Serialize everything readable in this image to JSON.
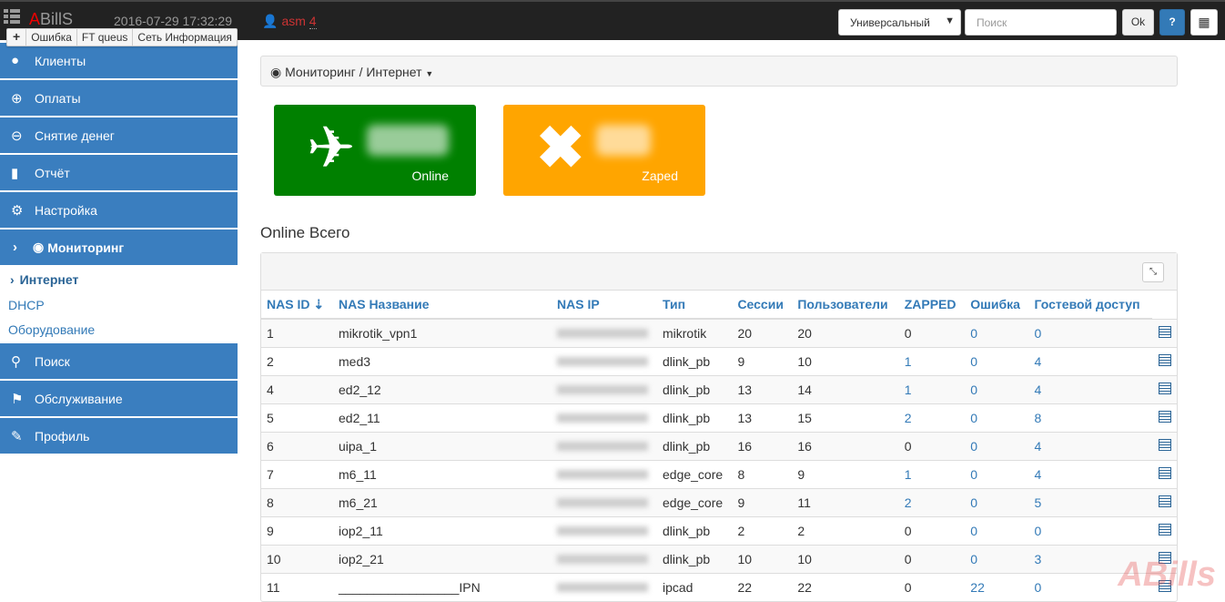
{
  "topbar": {
    "logo_first": "A",
    "logo_rest": "BillS",
    "datetime": "2016-07-29 17:32:29",
    "user": "asm",
    "user_num": "4",
    "select": "Универсальный",
    "search_placeholder": "Поиск",
    "ok": "Ok",
    "help": "?"
  },
  "quick": [
    "+",
    "Ошибка",
    "FT queus",
    "Сеть Информация"
  ],
  "sidebar": {
    "items": [
      {
        "label": "Клиенты",
        "icon": "user-icon"
      },
      {
        "label": "Оплаты",
        "icon": "plus-circle-icon"
      },
      {
        "label": "Снятие денег",
        "icon": "minus-circle-icon"
      },
      {
        "label": "Отчёт",
        "icon": "bar-chart-icon"
      },
      {
        "label": "Настройка",
        "icon": "gear-icon"
      },
      {
        "label": "Мониторинг",
        "icon": "eye-icon"
      }
    ],
    "sub": [
      "Интернет",
      "DHCP",
      "Оборудование"
    ],
    "items2": [
      {
        "label": "Поиск",
        "icon": "search-icon"
      },
      {
        "label": "Обслуживание",
        "icon": "flag-icon"
      },
      {
        "label": "Профиль",
        "icon": "wrench-icon"
      }
    ]
  },
  "breadcrumb": "Мониторинг / Интернет",
  "tiles": [
    {
      "label": "Online",
      "color": "#008000"
    },
    {
      "label": "Zaped",
      "color": "#ffa500"
    }
  ],
  "section_title": "Online Всего",
  "table": {
    "headers": [
      "NAS ID",
      "NAS Название",
      "NAS IP",
      "Тип",
      "Сессии",
      "Пользователи",
      "ZAPPED",
      "Ошибка",
      "Гостевой доступ"
    ],
    "rows": [
      [
        "1",
        "mikrotik_vpn1",
        "mikrotik",
        "20",
        "20",
        "0",
        "0",
        "0"
      ],
      [
        "2",
        "med3",
        "dlink_pb",
        "9",
        "10",
        "1",
        "0",
        "4"
      ],
      [
        "4",
        "ed2_12",
        "dlink_pb",
        "13",
        "14",
        "1",
        "0",
        "4"
      ],
      [
        "5",
        "ed2_11",
        "dlink_pb",
        "13",
        "15",
        "2",
        "0",
        "8"
      ],
      [
        "6",
        "uipa_1",
        "dlink_pb",
        "16",
        "16",
        "0",
        "0",
        "4"
      ],
      [
        "7",
        "m6_11",
        "edge_core",
        "8",
        "9",
        "1",
        "0",
        "4"
      ],
      [
        "8",
        "m6_21",
        "edge_core",
        "9",
        "11",
        "2",
        "0",
        "5"
      ],
      [
        "9",
        "iop2_11",
        "dlink_pb",
        "2",
        "2",
        "0",
        "0",
        "0"
      ],
      [
        "10",
        "iop2_21",
        "dlink_pb",
        "10",
        "10",
        "0",
        "0",
        "3"
      ],
      [
        "11",
        "_________________IPN",
        "ipcad",
        "22",
        "22",
        "0",
        "22",
        "0"
      ]
    ]
  },
  "watermark": "ABills"
}
